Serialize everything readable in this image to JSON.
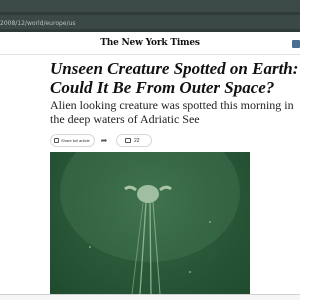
{
  "browser": {
    "url": "2008/12/world/europe/us"
  },
  "header": {
    "masthead": "The New York Times"
  },
  "article": {
    "headline_line1": "Unseen Creature Spotted on Earth:",
    "headline_line2": "Could It Be From Outer Space?",
    "summary_line1": "Alien looking creature was spotted this morning in",
    "summary_line2": "the deep waters of Adriatic See",
    "share_label": "Share full article",
    "comment_count": "22"
  },
  "colors": {
    "photo_bg": "#2b5a3a",
    "subscribe_accent": "#4b6f93"
  }
}
